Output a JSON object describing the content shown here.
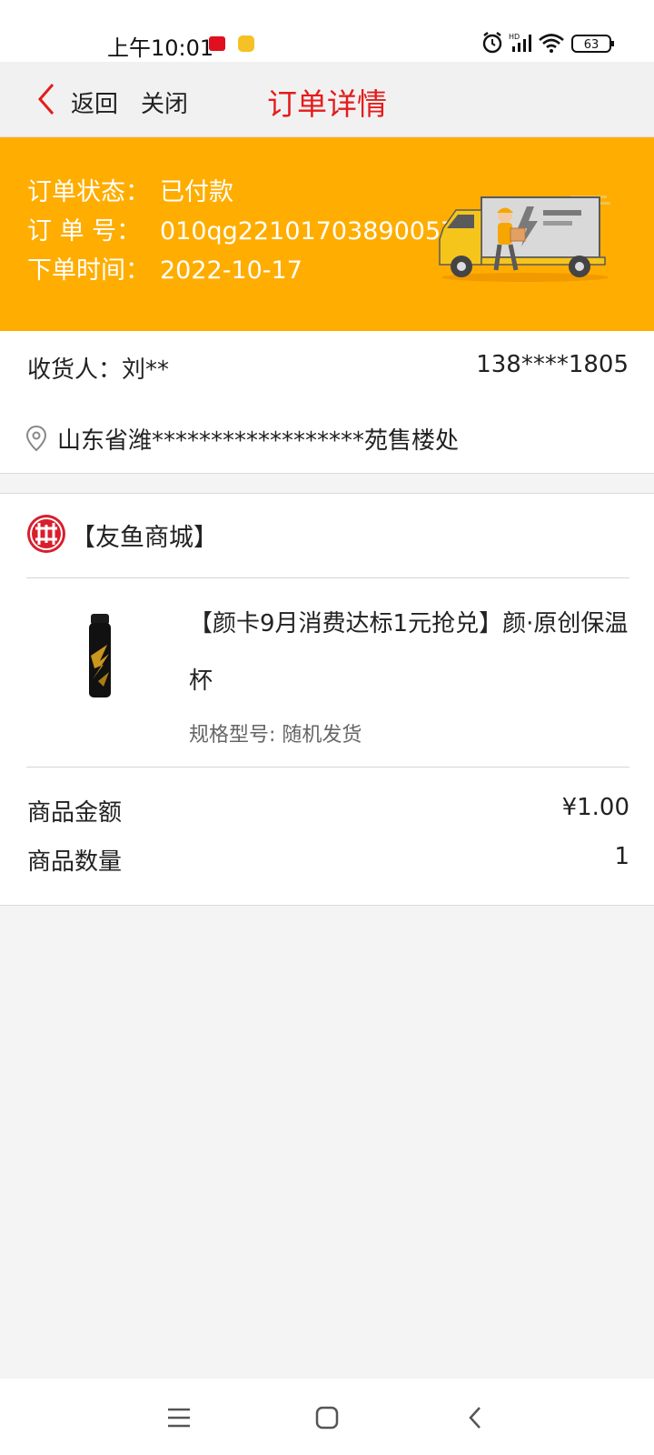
{
  "status_bar": {
    "time": "上午10:01",
    "icons": [
      "app-notification-icon",
      "app-notification-icon-2",
      "alarm-icon",
      "hd-signal-icon",
      "wifi-icon",
      "battery-icon"
    ],
    "battery_level": "63"
  },
  "nav": {
    "back_label": "返回",
    "close_label": "关闭",
    "title": "订单详情",
    "title_color": "#e41c1c"
  },
  "order": {
    "status_label": "订单状态：",
    "status_value": "已付款",
    "number_label": "订 单 号：",
    "number_value": "010qg22101703890057",
    "time_label": "下单时间：",
    "time_value": "2022-10-17",
    "banner_color": "#ffad00"
  },
  "receiver": {
    "name": "收货人：刘**",
    "phone": "138****1805",
    "address": "山东省潍******************苑售楼处"
  },
  "shop": {
    "name": "【友鱼商城】"
  },
  "product": {
    "title": "【颜卡9月消费达标1元抢兑】颜·原创保温杯",
    "spec": "规格型号: 随机发货"
  },
  "summary": {
    "amount_label": "商品金额",
    "amount_value": "¥1.00",
    "quantity_label": "商品数量",
    "quantity_value": "1"
  },
  "bottom_nav": {
    "icons": [
      "menu-icon",
      "home-icon",
      "back-icon"
    ]
  }
}
